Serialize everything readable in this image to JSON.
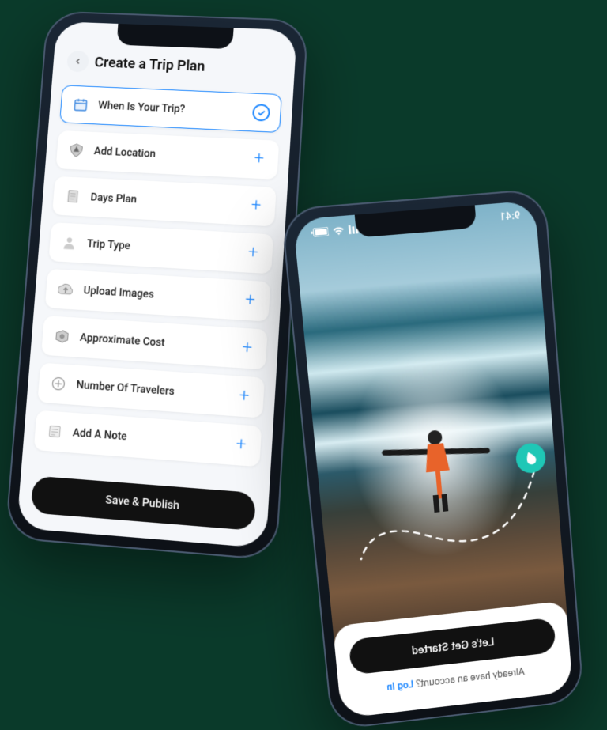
{
  "phone1": {
    "header_title": "Create a Trip Plan",
    "rows": [
      {
        "label": "When Is Your Trip?",
        "icon": "calendar-icon",
        "selected": true
      },
      {
        "label": "Add Location",
        "icon": "location-icon"
      },
      {
        "label": "Days Plan",
        "icon": "days-icon"
      },
      {
        "label": "Trip Type",
        "icon": "person-icon"
      },
      {
        "label": "Upload Images",
        "icon": "upload-icon"
      },
      {
        "label": "Approximate Cost",
        "icon": "cost-icon"
      },
      {
        "label": "Number Of Travelers",
        "icon": "travelers-icon"
      },
      {
        "label": "Add A Note",
        "icon": "note-icon"
      }
    ],
    "save_label": "Save & Publish"
  },
  "phone2": {
    "status_time": "9:41",
    "cta_label": "Let's Get Started",
    "login_prompt": "Already have an account? ",
    "login_link": "Log In"
  }
}
